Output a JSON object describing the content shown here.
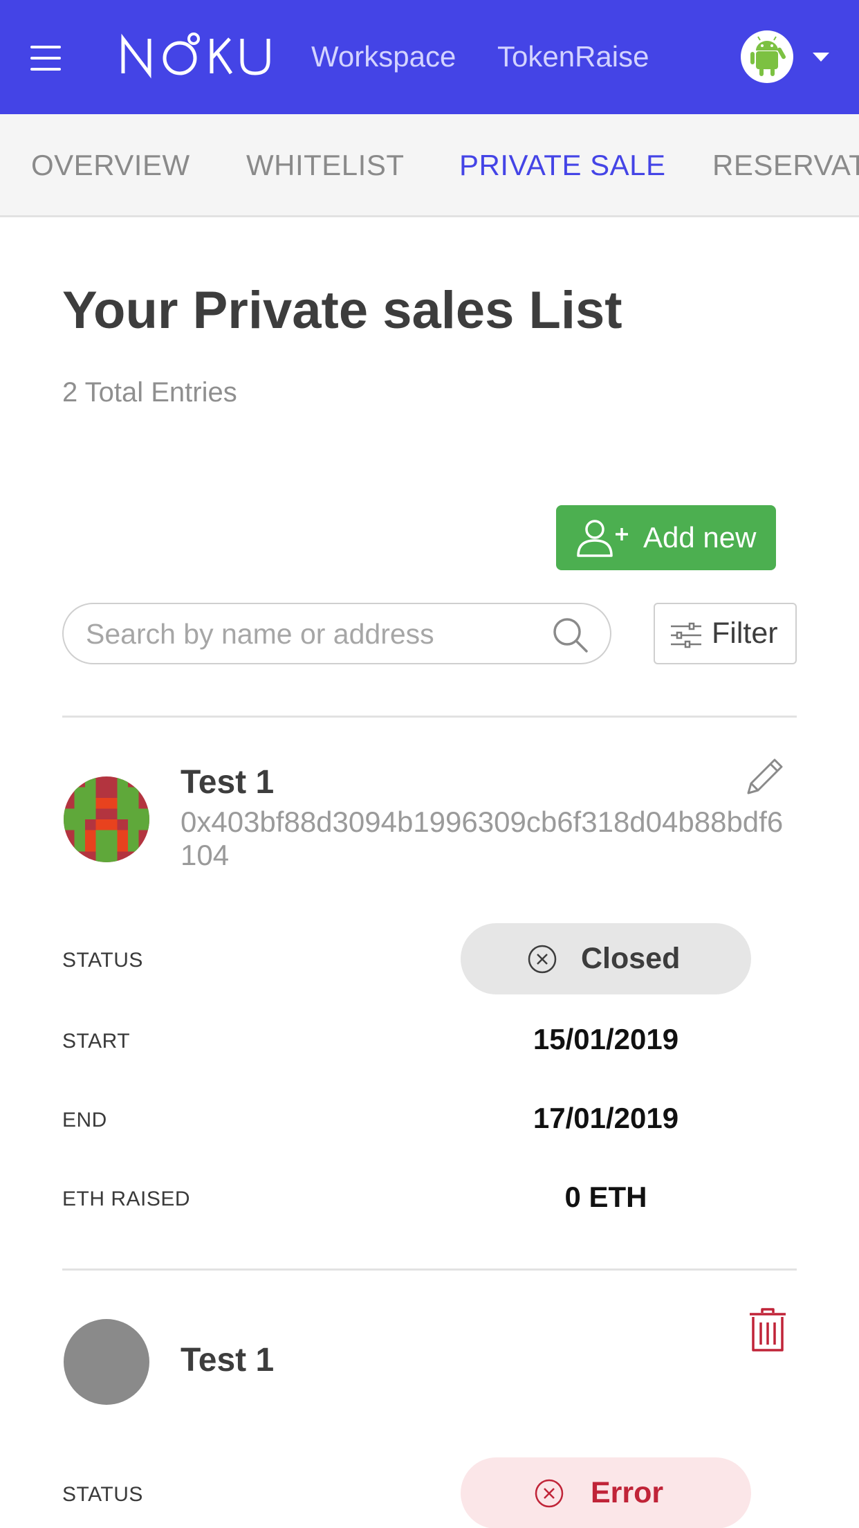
{
  "header": {
    "logo_text": "NOKU",
    "nav": {
      "workspace": "Workspace",
      "tokenraise": "TokenRaise"
    },
    "brand_color": "#4444e6"
  },
  "tabs": [
    {
      "label": "OVERVIEW",
      "active": false
    },
    {
      "label": "WHITELIST",
      "active": false
    },
    {
      "label": "PRIVATE SALE",
      "active": true
    },
    {
      "label": "RESERVATI",
      "active": false
    }
  ],
  "main": {
    "title": "Your Private sales List",
    "entries": "2 Total Entries",
    "add_button": "Add new",
    "search": {
      "placeholder": "Search by name or address",
      "value": ""
    },
    "filter_button": "Filter"
  },
  "cards": [
    {
      "name": "Test 1",
      "address": "0x403bf88d3094b1996309cb6f318d04b88bdf6104",
      "action_icon": "pencil-icon",
      "rows": {
        "status_label": "STATUS",
        "status_value": "Closed",
        "start_label": "START",
        "start_value": "15/01/2019",
        "end_label": "END",
        "end_value": "17/01/2019",
        "eth_label": "ETH RAISED",
        "eth_value": "0 ETH"
      }
    },
    {
      "name": "Test 1",
      "action_icon": "trash-icon",
      "rows": {
        "status_label": "STATUS",
        "status_value": "Error"
      }
    }
  ],
  "colors": {
    "success": "#4caf50",
    "error": "#c02438",
    "muted": "#8a8a8a"
  }
}
